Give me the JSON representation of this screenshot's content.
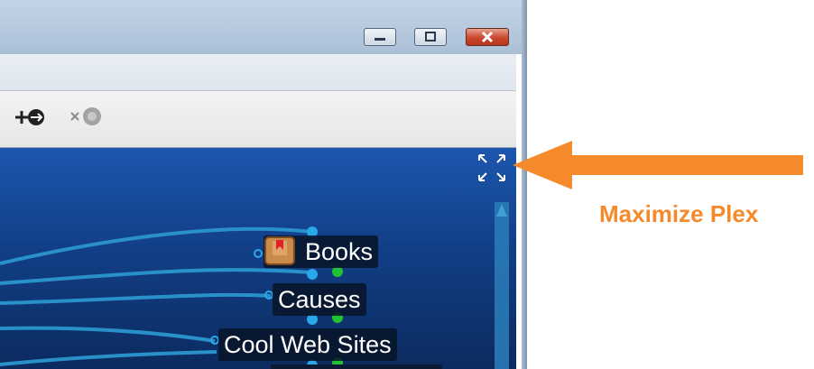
{
  "nodes": {
    "books": "Books",
    "causes": "Causes",
    "cool_web_sites": "Cool Web Sites"
  },
  "toolbar": {
    "add_link_icon": "add-link-icon",
    "remove_link_icon": "remove-link-icon"
  },
  "window_controls": [
    "minimize-icon",
    "restore-icon",
    "close-icon"
  ],
  "plex": {
    "maximize_icon": "maximize-plex-icon"
  },
  "annotation": {
    "label": "Maximize Plex"
  },
  "colors": {
    "accent": "#f58a2a",
    "plex_background": "#123f87",
    "connector_blue": "#29a7e8",
    "connector_green": "#22c233"
  }
}
